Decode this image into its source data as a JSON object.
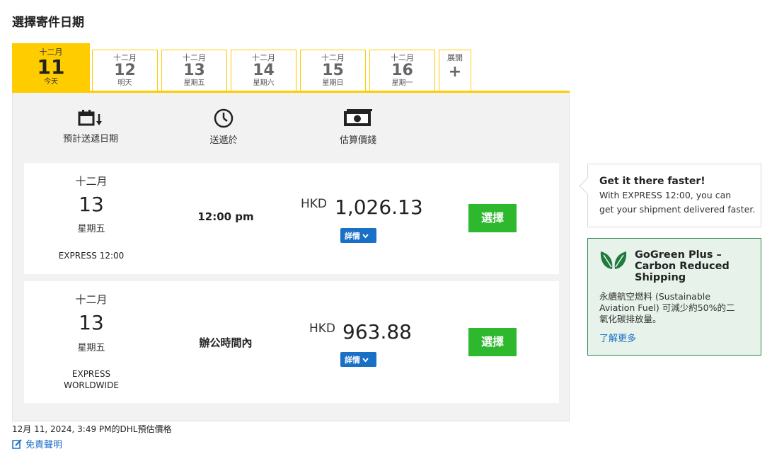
{
  "page": {
    "title": "選擇寄件日期"
  },
  "tabs": [
    {
      "month": "十二月",
      "day": "11",
      "weekday": "今天"
    },
    {
      "month": "十二月",
      "day": "12",
      "weekday": "明天"
    },
    {
      "month": "十二月",
      "day": "13",
      "weekday": "星期五"
    },
    {
      "month": "十二月",
      "day": "14",
      "weekday": "星期六"
    },
    {
      "month": "十二月",
      "day": "15",
      "weekday": "星期日"
    },
    {
      "month": "十二月",
      "day": "16",
      "weekday": "星期一"
    }
  ],
  "expand": {
    "label": "展開",
    "icon": "+"
  },
  "columns": {
    "estimated_date": "預計送遞日期",
    "delivered_by": "送遞於",
    "estimated_price": "估算價錢"
  },
  "services": [
    {
      "month": "十二月",
      "day": "13",
      "weekday": "星期五",
      "product": "EXPRESS 12:00",
      "time": "12:00 pm",
      "currency": "HKD",
      "amount": "1,026.13",
      "details_label": "詳情",
      "select_label": "選擇"
    },
    {
      "month": "十二月",
      "day": "13",
      "weekday": "星期五",
      "product_line1": "EXPRESS",
      "product_line2": "WORLDWIDE",
      "time": "辦公時間內",
      "currency": "HKD",
      "amount": "963.88",
      "details_label": "詳情",
      "select_label": "選擇"
    }
  ],
  "footer": {
    "timestamp": "12月 11, 2024, 3:49 PM的DHL預估價格",
    "disclaimer": "免責聲明"
  },
  "tip": {
    "heading": "Get it there faster!",
    "body_line1": "With EXPRESS 12:00, you can",
    "body_line2": "get your shipment delivered faster."
  },
  "gogreen": {
    "heading_line1": "GoGreen Plus –",
    "heading_line2": "Carbon Reduced",
    "heading_line3": "Shipping",
    "body_line1": "永續航空燃料 (Sustainable",
    "body_line2": "Aviation Fuel) 可減少約50%的二",
    "body_line3": "氧化碳排放量。",
    "link": "了解更多"
  },
  "colors": {
    "accent_yellow": "#ffcc00",
    "select_green": "#2eb82e",
    "link_blue": "#1a6fc6"
  }
}
